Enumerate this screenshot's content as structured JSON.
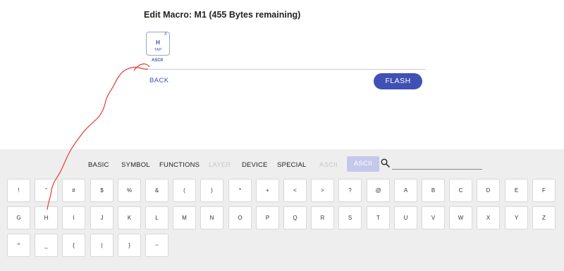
{
  "header": {
    "title": "Edit Macro: M1 (455 Bytes remaining)"
  },
  "macro": {
    "steps": [
      {
        "key": "H",
        "action": "TAP",
        "remove": "X",
        "type": "ASCII"
      }
    ]
  },
  "actions": {
    "back_label": "BACK",
    "flash_label": "FLASH"
  },
  "categories": [
    "BASIC",
    "SYMBOL",
    "FUNCTIONS",
    "LAYER",
    "DEVICE",
    "SPECIAL",
    "ASCII",
    "ASCII"
  ],
  "search": {
    "placeholder": "",
    "value": "",
    "icon": "search-icon"
  },
  "keyboard": {
    "rows": [
      [
        "!",
        "\"",
        "#",
        "$",
        "%",
        "&",
        "(",
        ")",
        "*",
        "+",
        "<",
        ">",
        "?",
        "@",
        "A",
        "B",
        "C",
        "D",
        "E",
        "F"
      ],
      [
        "G",
        "H",
        "I",
        "J",
        "K",
        "L",
        "M",
        "N",
        "O",
        "P",
        "Q",
        "R",
        "S",
        "T",
        "U",
        "V",
        "W",
        "X",
        "Y",
        "Z"
      ],
      [
        "^",
        "_",
        "{",
        "|",
        "}",
        "~"
      ]
    ]
  },
  "colors": {
    "accent": "#3f51b5",
    "active_tab": "#c5c8ea",
    "panel_bg": "#eeeeee",
    "annotation": "#e53935"
  }
}
